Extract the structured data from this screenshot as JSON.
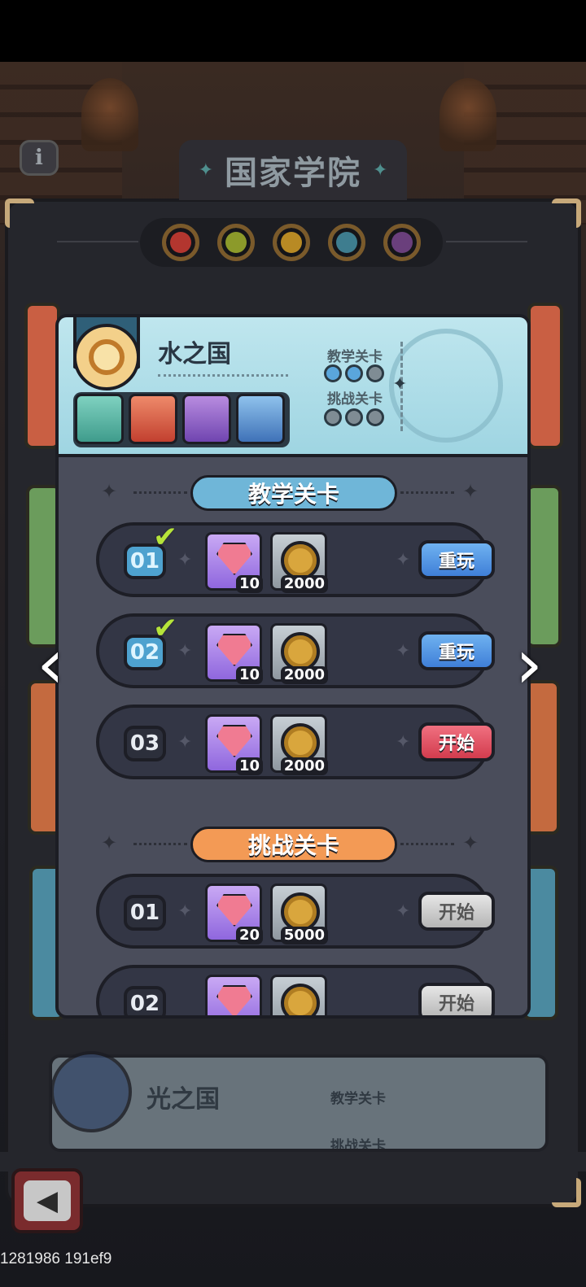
{
  "header": {
    "title": "国家学院",
    "info_icon": "i"
  },
  "element_dots": {
    "colors": [
      "#b3362f",
      "#8c9a2a",
      "#b88a24",
      "#3e7d8f",
      "#6a3f7c"
    ]
  },
  "country": {
    "name": "水之国",
    "progress": {
      "teaching_label": "教学关卡",
      "teaching_done": 2,
      "teaching_total": 3,
      "challenge_label": "挑战关卡",
      "challenge_done": 0,
      "challenge_total": 3
    },
    "heroes": [
      {
        "name": "hero-1",
        "color": "#58b7a4"
      },
      {
        "name": "hero-2",
        "color": "#d24a3b"
      },
      {
        "name": "hero-3",
        "color": "#8a55c4"
      },
      {
        "name": "hero-4",
        "color": "#4f86c8"
      }
    ]
  },
  "teaching": {
    "label": "教学关卡",
    "levels": [
      {
        "num": "01",
        "gems": "10",
        "coins": "2000",
        "button": "重玩",
        "completed": true
      },
      {
        "num": "02",
        "gems": "10",
        "coins": "2000",
        "button": "重玩",
        "completed": true
      },
      {
        "num": "03",
        "gems": "10",
        "coins": "2000",
        "button": "开始",
        "completed": false
      }
    ]
  },
  "challenge": {
    "label": "挑战关卡",
    "levels": [
      {
        "num": "01",
        "gems": "20",
        "coins": "5000",
        "button": "开始",
        "completed": false
      },
      {
        "num": "02",
        "gems": "",
        "coins": "",
        "button": "开始",
        "completed": false
      }
    ]
  },
  "next_country": {
    "name": "光之国",
    "teaching_label": "教学关卡",
    "challenge_label": "挑战关卡"
  },
  "footer": {
    "debug_text": "1281986 191ef9"
  }
}
